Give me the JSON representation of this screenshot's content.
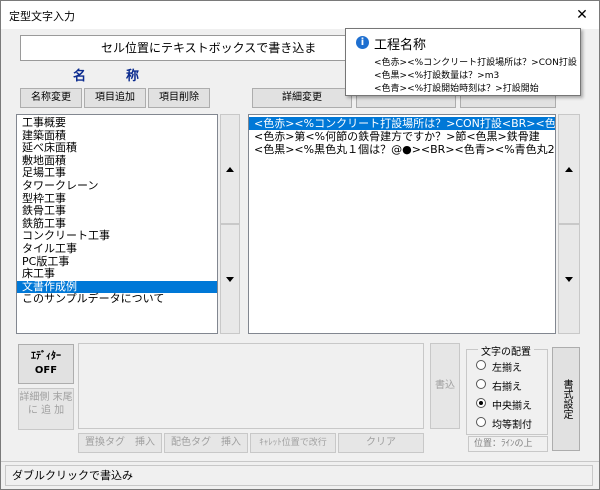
{
  "window": {
    "title": "定型文字入力",
    "close_label": "✕"
  },
  "banner": {
    "text": "セル位置にテキストボックスで書き込ま"
  },
  "name_section": {
    "label": "名称"
  },
  "buttons": {
    "rename": "名称変更",
    "add_item": "項目追加",
    "delete_item": "項目削除",
    "detail_change": "詳細変更",
    "editor_off": "ｴﾃﾞｨﾀｰ OFF",
    "write": "書込",
    "append_detail": "詳細側 末尾に 追 加",
    "insert_replace_tag": "置換タグ　挿入",
    "insert_color_tag": "配色タグ　挿入",
    "newline_at_caret": "ｷｬﾚｯﾄ位置で改行",
    "clear": "クリア",
    "format_settings": "書式設定"
  },
  "name_list": {
    "items": [
      "工事概要",
      "建築面積",
      "延べ床面積",
      "敷地面積",
      "足場工事",
      "タワークレーン",
      "型枠工事",
      "鉄骨工事",
      "鉄筋工事",
      "コンクリート工事",
      "タイル工事",
      "PC版工事",
      "床工事",
      "文書作成例",
      "このサンプルデータについて"
    ],
    "selected_index": 13
  },
  "detail_list": {
    "items": [
      "<色赤><%コンクリート打設場所は？>CON打設<BR><色黒",
      "<色赤>第<%何節の鉄骨建方ですか？>節<色黒>鉄骨建",
      "<色黒><%黒色丸１個は？@●><BR><色青><%青色丸2"
    ],
    "selected_index": 0
  },
  "alignment": {
    "label": "文字の配置",
    "options": [
      "左揃え",
      "右揃え",
      "中央揃え",
      "均等割付"
    ],
    "selected_index": 2,
    "position_text": "位置：ﾗｲﾝの上"
  },
  "status_bar": {
    "text": "ダブルクリックで書込み"
  },
  "tooltip": {
    "title": "工程名称",
    "lines": [
      "<色赤><%コンクリート打設場所は？>CON打設",
      "<色黒><%打設数量は？>m3",
      "<色青><%打設開始時刻は？>打設開始"
    ]
  },
  "colors": {
    "selection": "#0078d7",
    "label_blue": "#0b2b8f",
    "info_icon": "#1e6fd0"
  }
}
